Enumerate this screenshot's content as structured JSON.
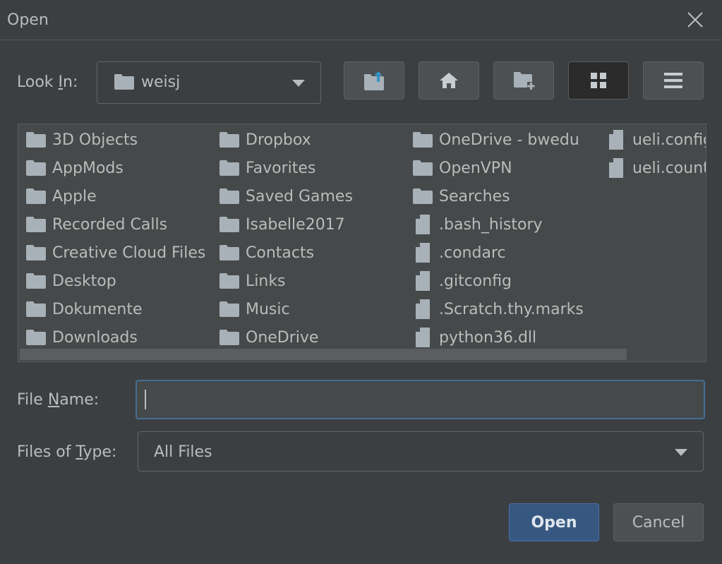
{
  "dialog": {
    "title": "Open"
  },
  "look_in": {
    "label_pre": "Look ",
    "label_mnemonic": "I",
    "label_post": "n:",
    "value": "weisj"
  },
  "toolbar": {
    "buttons": [
      {
        "icon": "up-folder-icon"
      },
      {
        "icon": "home-icon"
      },
      {
        "icon": "new-folder-icon"
      },
      {
        "icon": "grid-view-icon",
        "selected": true
      },
      {
        "icon": "list-view-icon"
      }
    ]
  },
  "files": {
    "columns": [
      [
        {
          "name": "3D Objects",
          "type": "folder"
        },
        {
          "name": "AppMods",
          "type": "folder"
        },
        {
          "name": "Apple",
          "type": "folder"
        },
        {
          "name": "Recorded Calls",
          "type": "folder"
        },
        {
          "name": "Creative Cloud Files",
          "type": "folder"
        },
        {
          "name": "Desktop",
          "type": "folder"
        },
        {
          "name": "Dokumente",
          "type": "folder"
        },
        {
          "name": "Downloads",
          "type": "folder"
        }
      ],
      [
        {
          "name": "Dropbox",
          "type": "folder"
        },
        {
          "name": "Favorites",
          "type": "folder"
        },
        {
          "name": "Saved Games",
          "type": "folder"
        },
        {
          "name": "Isabelle2017",
          "type": "folder"
        },
        {
          "name": "Contacts",
          "type": "folder"
        },
        {
          "name": "Links",
          "type": "folder"
        },
        {
          "name": "Music",
          "type": "folder"
        },
        {
          "name": "OneDrive",
          "type": "folder"
        }
      ],
      [
        {
          "name": "OneDrive - bwedu",
          "type": "folder"
        },
        {
          "name": "OpenVPN",
          "type": "folder"
        },
        {
          "name": "Searches",
          "type": "folder"
        },
        {
          "name": ".bash_history",
          "type": "file"
        },
        {
          "name": ".condarc",
          "type": "file"
        },
        {
          "name": ".gitconfig",
          "type": "file"
        },
        {
          "name": ".Scratch.thy.marks",
          "type": "file"
        },
        {
          "name": "python36.dll",
          "type": "file"
        }
      ],
      [
        {
          "name": "ueli.config",
          "type": "file"
        },
        {
          "name": "ueli.count",
          "type": "file"
        }
      ]
    ]
  },
  "file_name": {
    "label_pre": "File ",
    "label_mnemonic": "N",
    "label_post": "ame:",
    "value": ""
  },
  "files_of_type": {
    "label_pre": "Files of ",
    "label_mnemonic": "T",
    "label_post": "ype:",
    "value": "All Files"
  },
  "buttons": {
    "open": "Open",
    "cancel": "Cancel"
  },
  "colors": {
    "background": "#3c3f41",
    "list": "#45494a",
    "accent": "#365880",
    "focus": "#466d94",
    "text": "#bbbbbb",
    "icon": "#a9b1b8"
  }
}
